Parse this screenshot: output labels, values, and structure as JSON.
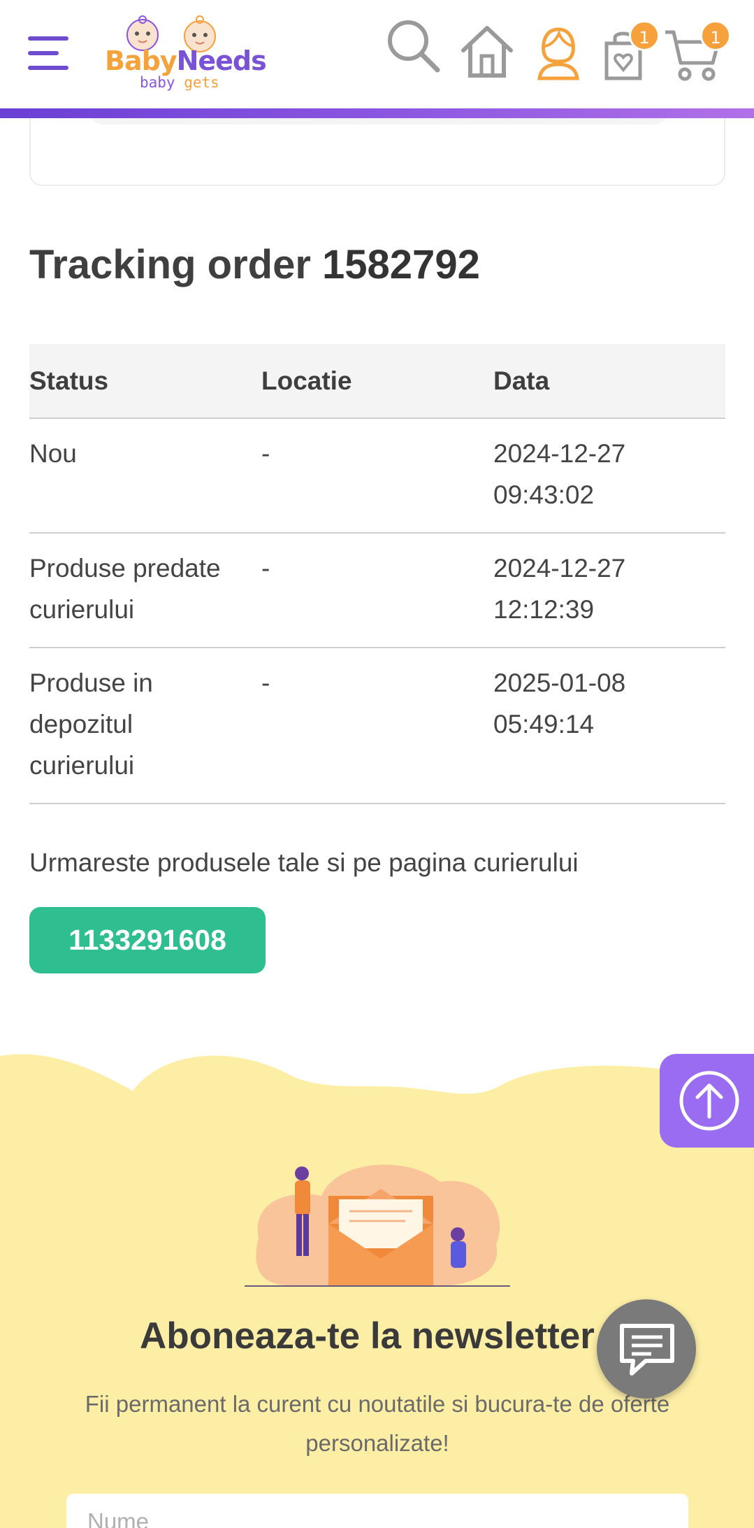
{
  "header": {
    "logo": {
      "brand_part1": "Baby",
      "brand_part2": "Needs",
      "tagline_part1": "baby ",
      "tagline_part2": "gets"
    },
    "wishlist_count": "1",
    "cart_count": "1",
    "icons": [
      "menu-icon",
      "search-icon",
      "home-icon",
      "account-icon",
      "wishlist-icon",
      "cart-icon"
    ],
    "accent_color": "#6f4bcf"
  },
  "tracking": {
    "title_prefix": "Tracking order ",
    "order_number": "1582792",
    "columns": [
      "Status",
      "Locatie",
      "Data"
    ],
    "rows": [
      {
        "status": "Nou",
        "location": "-",
        "date": "2024-12-27",
        "time": "09:43:02"
      },
      {
        "status_line1": "Produse predate",
        "status_line2": "curierului",
        "location": "-",
        "date": "2024-12-27",
        "time": "12:12:39"
      },
      {
        "status_line1": "Produse in",
        "status_line2": "depozitul",
        "status_line3": "curierului",
        "location": "-",
        "date": "2025-01-08",
        "time": "05:49:14"
      }
    ],
    "follow_text": "Urmareste produsele tale si pe pagina curierului",
    "awb_number": "1133291608",
    "button_color": "#2fbe8f"
  },
  "newsletter": {
    "title": "Aboneaza-te la newsletter",
    "subtitle": "Fii permanent la curent cu noutatile si bucura-te de oferte personalizate!",
    "name_placeholder": "Nume",
    "background_color": "#fdeea6"
  },
  "floating": {
    "scroll_top_icon": "arrow-up-icon",
    "chat_icon": "chat-icon"
  }
}
